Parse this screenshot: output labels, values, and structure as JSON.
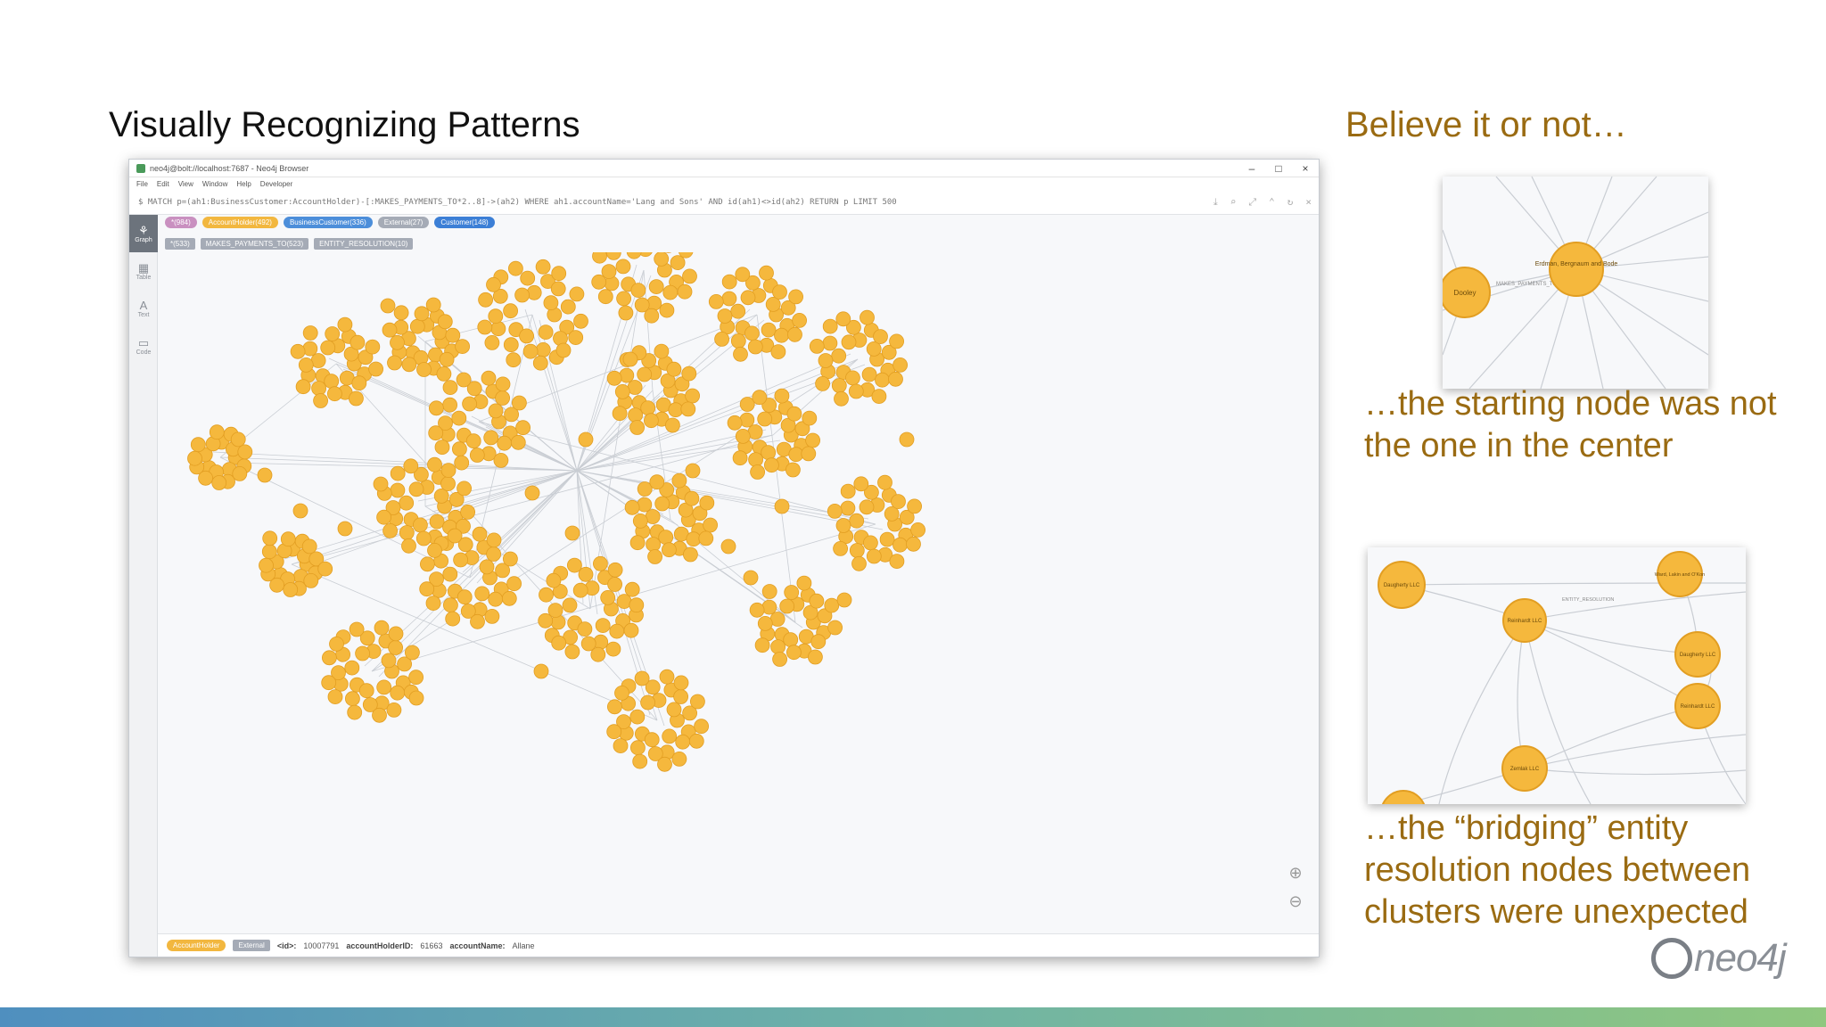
{
  "slide": {
    "title": "Visually Recognizing Patterns",
    "side_heading": "Believe it or not…",
    "caption1": "…the starting node was not the one in the center",
    "caption2": "…the “bridging” entity resolution nodes between clusters were unexpected"
  },
  "browser": {
    "window_title": "neo4j@bolt://localhost:7687 - Neo4j Browser",
    "menu": [
      "File",
      "Edit",
      "View",
      "Window",
      "Help",
      "Developer"
    ],
    "query": "$ MATCH p=(ah1:BusinessCustomer:AccountHolder)-[:MAKES_PAYMENTS_TO*2..8]->(ah2) WHERE ah1.accountName='Lang and Sons' AND id(ah1)<>id(ah2) RETURN p LIMIT 500",
    "rail": [
      {
        "label": "Graph",
        "icon": "graph-icon"
      },
      {
        "label": "Table",
        "icon": "table-icon"
      },
      {
        "label": "Text",
        "icon": "text-icon"
      },
      {
        "label": "Code",
        "icon": "code-icon"
      }
    ],
    "node_labels": [
      {
        "text": "*(984)",
        "color": "#c990c0"
      },
      {
        "text": "AccountHolder(492)",
        "color": "#f2b73f"
      },
      {
        "text": "BusinessCustomer(336)",
        "color": "#4c8eda"
      },
      {
        "text": "External(27)",
        "color": "#a5abb6"
      },
      {
        "text": "Customer(148)",
        "color": "#3c7fd6"
      }
    ],
    "rel_types": [
      "*(533)",
      "MAKES_PAYMENTS_TO(523)",
      "ENTITY_RESOLUTION(10)"
    ],
    "status": {
      "label": "AccountHolder",
      "tag": "External",
      "id_key": "<id>:",
      "id_val": "10007791",
      "holder_key": "accountHolderID:",
      "holder_val": "61663",
      "name_key": "accountName:",
      "name_val": "Allane"
    },
    "node_color": "#f5b83d",
    "edge_color": "#c9cdd3"
  },
  "inset1": {
    "center_label": "Erdman, Bergnaum and Bode",
    "left_label": "Dooley",
    "edge_label": "MAKES_PAYMENTS_TO"
  },
  "inset2": {
    "labels": [
      "Daugherty LLC",
      "Reinhardt LLC",
      "Daugherty LLC",
      "Reinhardt LLC",
      "Zemlak LLC",
      "Ward, Lakin and O'Kon"
    ],
    "edge_label": "ENTITY_RESOLUTION"
  },
  "logo": {
    "text": "neo4j"
  }
}
